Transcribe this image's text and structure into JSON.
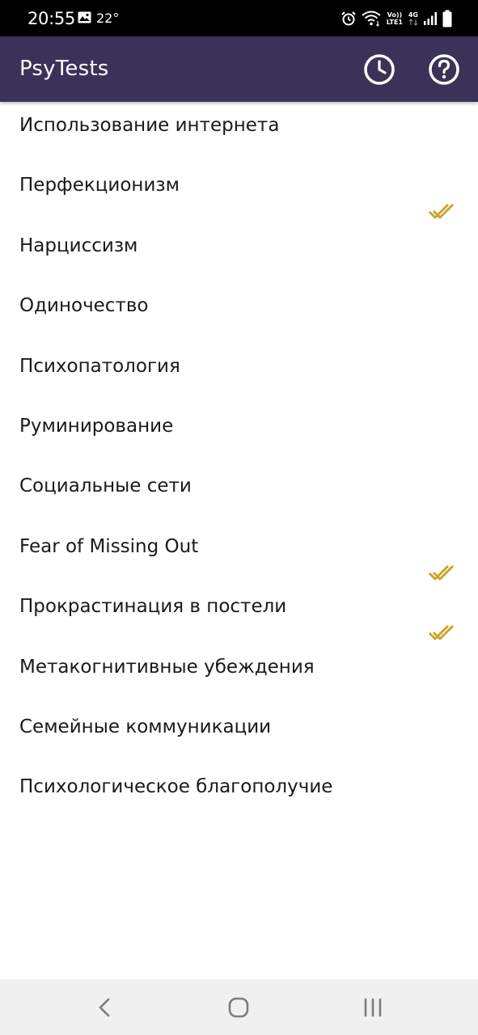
{
  "status_bar": {
    "time": "20:55",
    "temperature": "22°",
    "network_volte": "Vo)) LTE1",
    "network_type": "4G",
    "icons": [
      "gallery-icon",
      "alarm-icon",
      "wifi-icon",
      "signal-icon",
      "battery-icon"
    ]
  },
  "app_bar": {
    "title": "PsyTests",
    "background_color": "#3b3259",
    "actions": [
      {
        "icon": "history-icon"
      },
      {
        "icon": "help-icon"
      }
    ]
  },
  "tests": {
    "accent_color": "#c9a227",
    "items": [
      {
        "label": "Использование интернета",
        "completed": false
      },
      {
        "label": "Перфекционизм",
        "completed": true
      },
      {
        "label": "Нарциссизм",
        "completed": false
      },
      {
        "label": "Одиночество",
        "completed": false
      },
      {
        "label": "Психопатология",
        "completed": false
      },
      {
        "label": "Руминирование",
        "completed": false
      },
      {
        "label": "Социальные сети",
        "completed": false
      },
      {
        "label": "Fear of Missing Out",
        "completed": true
      },
      {
        "label": "Прокрастинация в постели",
        "completed": true
      },
      {
        "label": "Метакогнитивные убеждения",
        "completed": false
      },
      {
        "label": "Семейные коммуникации",
        "completed": false
      },
      {
        "label": "Психологическое благополучие",
        "completed": false
      }
    ]
  },
  "nav_bar": {
    "buttons": [
      "back-icon",
      "home-icon",
      "recents-icon"
    ]
  }
}
